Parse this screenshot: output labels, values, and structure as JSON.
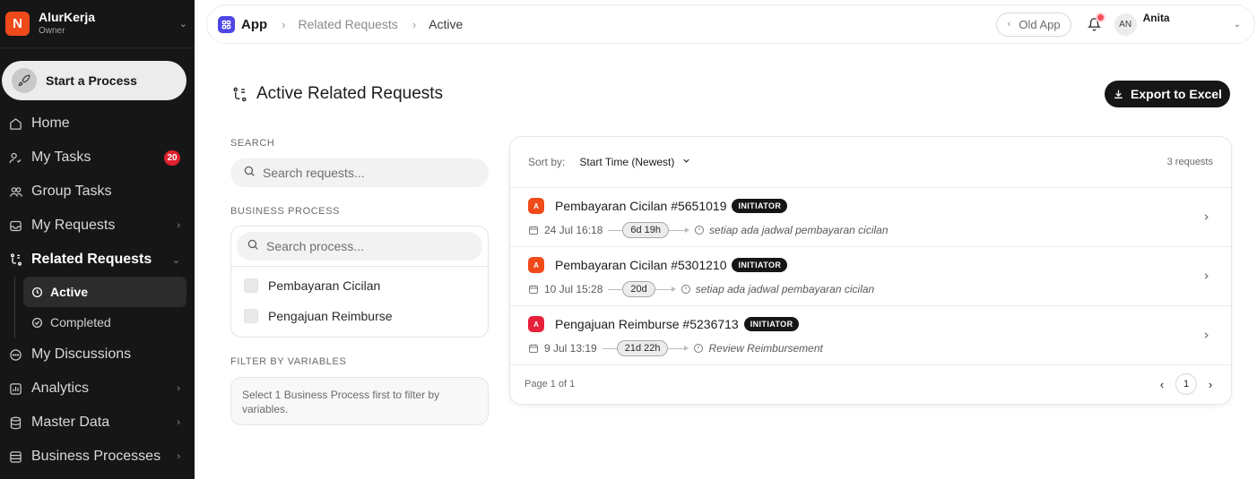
{
  "org": {
    "initial": "N",
    "name": "AlurKerja",
    "role": "Owner",
    "logo_color": "#f04a1a"
  },
  "start_process_label": "Start a Process",
  "nav": {
    "home": "Home",
    "my_tasks": "My Tasks",
    "my_tasks_badge": "20",
    "group_tasks": "Group Tasks",
    "my_requests": "My Requests",
    "related_requests": "Related Requests",
    "related_sub": {
      "active": "Active",
      "completed": "Completed"
    },
    "my_discussions": "My Discussions",
    "analytics": "Analytics",
    "master_data": "Master Data",
    "business_processes": "Business Processes"
  },
  "topbar": {
    "breadcrumb": [
      "App",
      "Related Requests",
      "Active"
    ],
    "old_app": "Old App",
    "avatar_initials": "AN",
    "user_name": "Anita"
  },
  "page": {
    "title": "Active Related Requests",
    "export_label": "Export to Excel"
  },
  "filters": {
    "search_label": "SEARCH",
    "search_placeholder": "Search requests...",
    "bp_label": "BUSINESS PROCESS",
    "bp_search_placeholder": "Search process...",
    "bp_options": [
      "Pembayaran Cicilan",
      "Pengajuan Reimburse"
    ],
    "vars_label": "FILTER BY VARIABLES",
    "vars_hint": "Select 1 Business Process first to filter by variables."
  },
  "results": {
    "sort_label": "Sort by:",
    "sort_value": "Start Time (Newest)",
    "count": "3 requests",
    "rows": [
      {
        "avatar": "A",
        "avatar_color": "#f04a1a",
        "title": "Pembayaran Cicilan",
        "id": "#5651019",
        "badge": "INITIATOR",
        "date": "24 Jul 16:18",
        "duration": "6d 19h",
        "step": "setiap ada jadwal pembayaran cicilan"
      },
      {
        "avatar": "A",
        "avatar_color": "#f04a1a",
        "title": "Pembayaran Cicilan",
        "id": "#5301210",
        "badge": "INITIATOR",
        "date": "10 Jul 15:28",
        "duration": "20d",
        "step": "setiap ada jadwal pembayaran cicilan"
      },
      {
        "avatar": "A",
        "avatar_color": "#e8203a",
        "title": "Pengajuan Reimburse",
        "id": "#5236713",
        "badge": "INITIATOR",
        "date": "9 Jul 13:19",
        "duration": "21d 22h",
        "step": "Review Reimbursement"
      }
    ],
    "page_info": "Page 1 of 1",
    "current_page": "1"
  }
}
